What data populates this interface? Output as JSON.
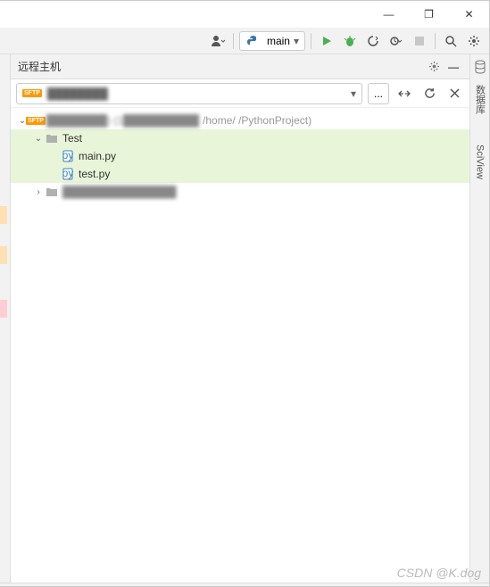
{
  "window": {
    "minimize": "—",
    "maximize": "❐",
    "close": "✕"
  },
  "toolbar": {
    "user_menu": "user-dropdown",
    "run_config": {
      "icon": "python-icon",
      "label": "main",
      "dropdown": "▾"
    },
    "run": "▶",
    "debug": "🐞",
    "coverage": "↻",
    "profile": "⟳▾",
    "stop": "■",
    "search": "🔍",
    "settings": "⚙"
  },
  "panel": {
    "title": "远程主机",
    "gear": "⚙",
    "hide": "—"
  },
  "host_bar": {
    "sftp_badge": "SFTP",
    "host_blur": "████████",
    "dropdown": "▾",
    "more": "...",
    "collapse": "⇆",
    "refresh": "⟳",
    "close": "✕"
  },
  "tree": {
    "root": {
      "chev": "⌄",
      "sftp": "SFTP",
      "name_blur": "████████) (1██████████",
      "path": "/home/   /PythonProject)"
    },
    "test_folder": {
      "chev": "⌄",
      "name": "Test"
    },
    "main_py": {
      "name": "main.py"
    },
    "test_py": {
      "name": "test.py"
    },
    "other": {
      "chev": "›",
      "name_blur": "███████████████"
    }
  },
  "sidebar": {
    "db_label": "数据库",
    "sciview_label": "SciView"
  },
  "watermark": "CSDN @K.dog"
}
